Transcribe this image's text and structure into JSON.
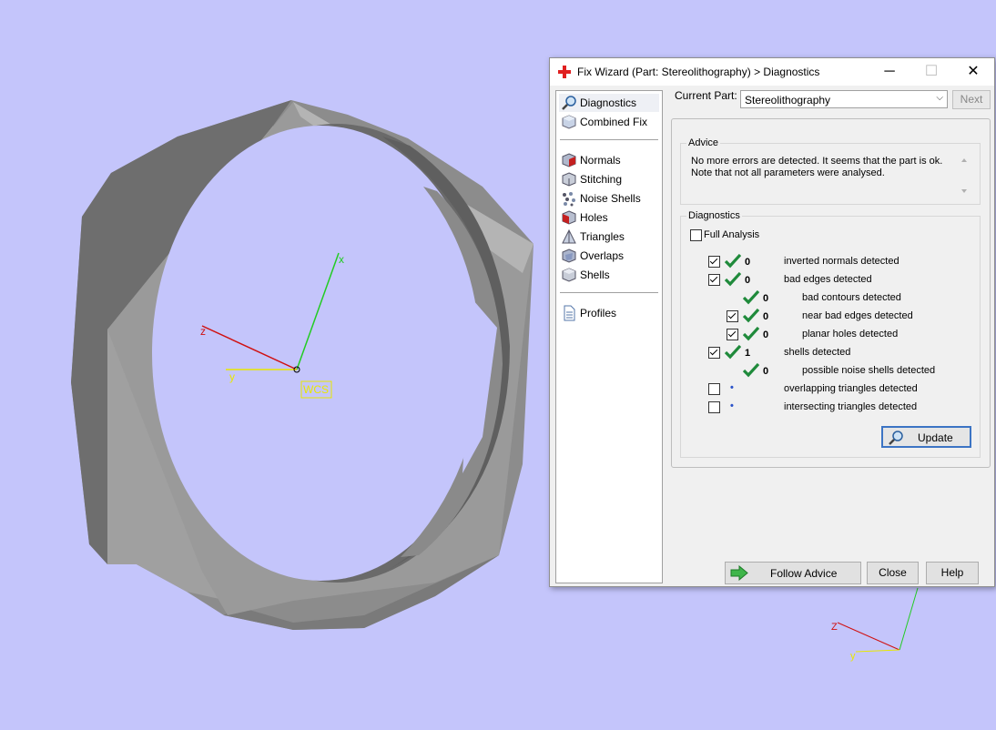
{
  "viewport": {
    "wcs_label": "WCS",
    "axis_x": "x",
    "axis_y": "y",
    "axis_z": "z",
    "mini_axis_y": "y",
    "mini_axis_z": "Z"
  },
  "dialog": {
    "title": "Fix Wizard (Part: Stereolithography) > Diagnostics",
    "minimize": "─",
    "maximize": "☐",
    "close": "✕",
    "sidebar": {
      "items": [
        {
          "label": "Diagnostics",
          "icon": "magnifier-icon"
        },
        {
          "label": "Combined Fix",
          "icon": "cube-icon"
        },
        {
          "label": "Normals",
          "icon": "normals-cube-icon"
        },
        {
          "label": "Stitching",
          "icon": "stitching-cube-icon"
        },
        {
          "label": "Noise Shells",
          "icon": "noise-shells-icon"
        },
        {
          "label": "Holes",
          "icon": "holes-cube-icon"
        },
        {
          "label": "Triangles",
          "icon": "triangles-icon"
        },
        {
          "label": "Overlaps",
          "icon": "overlaps-icon"
        },
        {
          "label": "Shells",
          "icon": "shells-icon"
        },
        {
          "label": "Profiles",
          "icon": "document-icon"
        }
      ]
    },
    "current_part_label": "Current Part:",
    "current_part_value": "Stereolithography",
    "next_label": "Next",
    "advice": {
      "title": "Advice",
      "line1": "No more errors are detected. It seems that the part is ok.",
      "line2": "Note that not all parameters were analysed."
    },
    "diagnostics": {
      "title": "Diagnostics",
      "full_analysis_label": "Full Analysis",
      "rows": [
        {
          "value": "0",
          "label": "inverted normals detected"
        },
        {
          "value": "0",
          "label": "bad edges detected"
        },
        {
          "value": "0",
          "label": "bad contours detected"
        },
        {
          "value": "0",
          "label": "near bad edges detected"
        },
        {
          "value": "0",
          "label": "planar holes detected"
        },
        {
          "value": "1",
          "label": "shells detected"
        },
        {
          "value": "0",
          "label": "possible noise shells detected"
        },
        {
          "value": "•",
          "label": "overlapping triangles detected"
        },
        {
          "value": "•",
          "label": "intersecting triangles detected"
        }
      ]
    },
    "update_label": "Update",
    "follow_advice_label": "Follow Advice",
    "close_label": "Close",
    "help_label": "Help"
  },
  "colors": {
    "background": "#c4c5fb",
    "check_green": "#1f8a3b",
    "axis_x": "#22cc22",
    "axis_y": "#e8e800",
    "axis_z": "#d01010"
  }
}
